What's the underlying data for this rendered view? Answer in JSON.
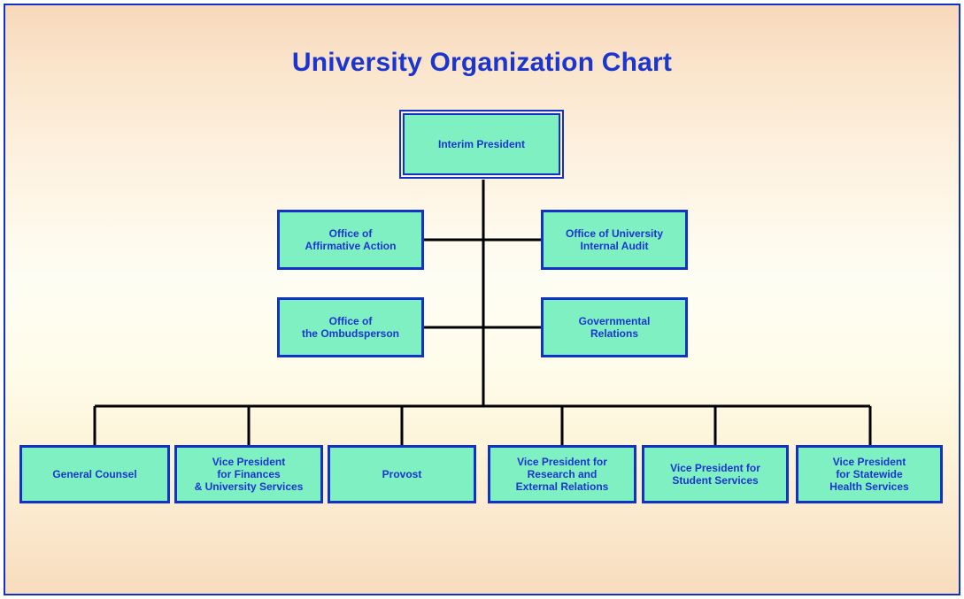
{
  "page": {
    "title": "University Organization Chart",
    "border_color": "#1033c4",
    "background_top_color": "#f7d9bb",
    "background_mid_color": "#fffdf0"
  },
  "theme": {
    "node_fill": "#7ef0c2",
    "node_border": "#1033c4",
    "text_color": "#1b35cf",
    "connector_color": "#000000"
  },
  "chart_data": {
    "type": "diagram",
    "diagram_type": "organization-chart",
    "title": "University Organization Chart",
    "root": {
      "id": "interim-president",
      "label": "Interim President"
    },
    "staff": [
      {
        "id": "office-of-affirmative-action",
        "label": "Office of\nAffirmative Action",
        "side": "left",
        "row": 1
      },
      {
        "id": "office-of-university-internal-audit",
        "label": "Office of University\nInternal Audit",
        "side": "right",
        "row": 1
      },
      {
        "id": "office-of-the-ombudsperson",
        "label": "Office of\nthe Ombudsperson",
        "side": "left",
        "row": 2
      },
      {
        "id": "governmental-relations",
        "label": "Governmental\nRelations",
        "side": "right",
        "row": 2
      }
    ],
    "divisions": [
      {
        "id": "general-counsel",
        "label": "General Counsel"
      },
      {
        "id": "vice-president-for-finances-and-university-services",
        "label": "Vice President\nfor Finances\n& University Services"
      },
      {
        "id": "provost",
        "label": "Provost"
      },
      {
        "id": "vice-president-for-research-and-external-relations",
        "label": "Vice President for\nResearch and\nExternal Relations"
      },
      {
        "id": "vice-president-for-student-services",
        "label": "Vice President for\nStudent Services"
      },
      {
        "id": "vice-president-for-statewide-health-services",
        "label": "Vice President\nfor Statewide\nHealth Services"
      }
    ],
    "edges": [
      {
        "from": "interim-president",
        "to": "office-of-affirmative-action",
        "style": "staff"
      },
      {
        "from": "interim-president",
        "to": "office-of-university-internal-audit",
        "style": "staff"
      },
      {
        "from": "interim-president",
        "to": "office-of-the-ombudsperson",
        "style": "staff"
      },
      {
        "from": "interim-president",
        "to": "governmental-relations",
        "style": "staff"
      },
      {
        "from": "interim-president",
        "to": "general-counsel",
        "style": "line"
      },
      {
        "from": "interim-president",
        "to": "vice-president-for-finances-and-university-services",
        "style": "line"
      },
      {
        "from": "interim-president",
        "to": "provost",
        "style": "line"
      },
      {
        "from": "interim-president",
        "to": "vice-president-for-research-and-external-relations",
        "style": "line"
      },
      {
        "from": "interim-president",
        "to": "vice-president-for-student-services",
        "style": "line"
      },
      {
        "from": "interim-president",
        "to": "vice-president-for-statewide-health-services",
        "style": "line"
      }
    ]
  }
}
